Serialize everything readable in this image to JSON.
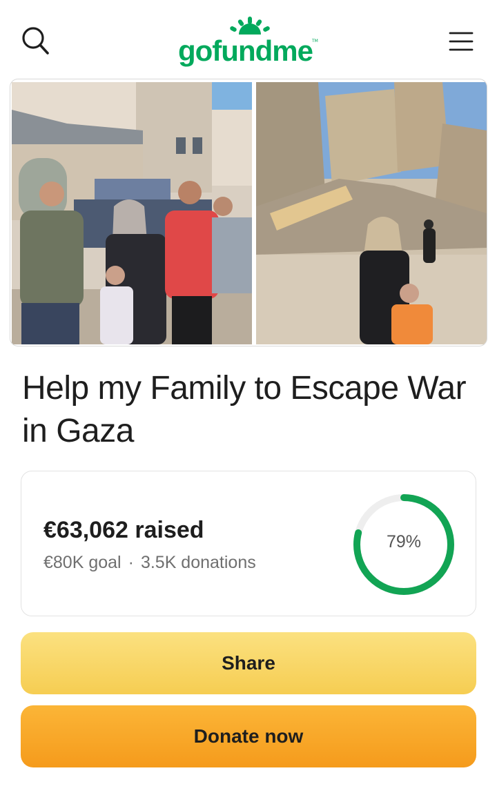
{
  "header": {
    "logo_text": "gofundme",
    "logo_tm": "TM",
    "search_icon": "search-icon",
    "menu_icon": "hamburger-menu-icon",
    "brand_color": "#02a95c"
  },
  "photos": [
    {
      "name": "family-photo"
    },
    {
      "name": "destroyed-buildings-photo"
    }
  ],
  "campaign": {
    "title": "Help my Family to Escape War in Gaza"
  },
  "stats": {
    "raised_amount": "€63,062",
    "raised_suffix": " raised",
    "goal": "€80K goal",
    "separator": "·",
    "donations": "3.5K donations",
    "progress_label": "79%",
    "progress_fraction": 0.79,
    "progress_color": "#12a454",
    "track_color": "#eeeeee"
  },
  "actions": {
    "share_label": "Share",
    "donate_label": "Donate now",
    "share_color": "#f8d768",
    "donate_color": "#f8a829"
  }
}
